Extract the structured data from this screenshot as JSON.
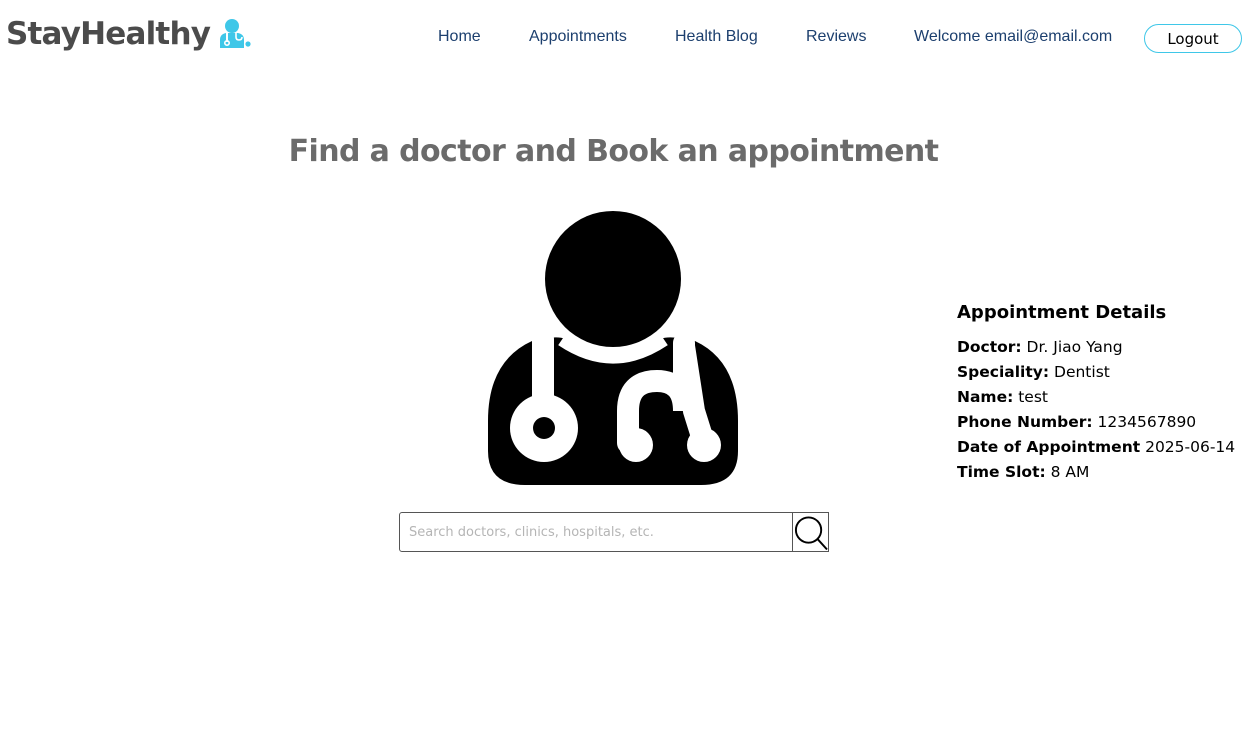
{
  "brand": {
    "name": "StayHealthy",
    "icon": "doctor-icon",
    "icon_color": "#3fc7e8"
  },
  "nav": {
    "home": "Home",
    "appointments": "Appointments",
    "health_blog": "Health Blog",
    "reviews": "Reviews",
    "welcome": "Welcome email@email.com",
    "logout": "Logout"
  },
  "main": {
    "headline": "Find a doctor and Book an appointment",
    "illustration": "doctor-stethoscope-icon",
    "search": {
      "placeholder": "Search doctors, clinics, hospitals, etc.",
      "button_icon": "search-icon"
    }
  },
  "appointment": {
    "title": "Appointment Details",
    "fields": [
      {
        "label": "Doctor:",
        "value": "Dr. Jiao Yang"
      },
      {
        "label": "Speciality:",
        "value": "Dentist"
      },
      {
        "label": "Name:",
        "value": "test"
      },
      {
        "label": "Phone Number:",
        "value": "1234567890"
      },
      {
        "label": "Date of Appointment",
        "value": "2025-06-14"
      },
      {
        "label": "Time Slot:",
        "value": "8 AM"
      }
    ]
  },
  "colors": {
    "brand_text": "#4b4b4b",
    "nav_link": "#1c3f6e",
    "accent": "#3fc7e8",
    "headline": "#6b6b6b"
  }
}
